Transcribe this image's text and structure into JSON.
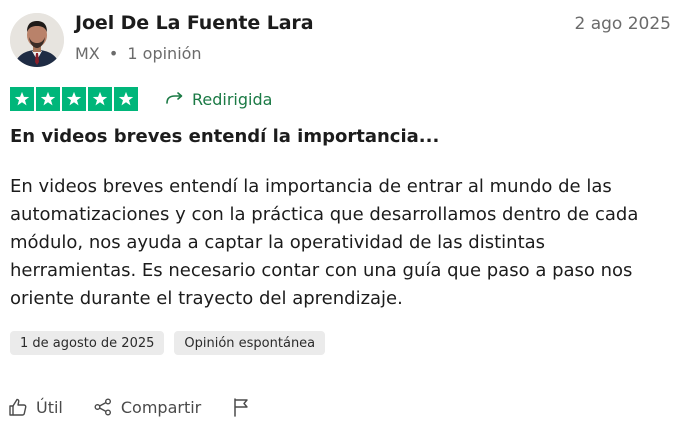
{
  "reviewer": {
    "name": "Joel De La Fuente Lara",
    "country": "MX",
    "separator": "•",
    "reviews_count": "1 opinión",
    "avatar": "profile-photo"
  },
  "review": {
    "date": "2 ago 2025",
    "rating": 5,
    "rating_max": 5,
    "star_color": "#00b67a",
    "redirect_label": "Redirigida",
    "redirect_color": "#1b7a45",
    "title": "En videos breves entendí la importancia...",
    "body": "En videos breves entendí la importancia de entrar al mundo de las automatizaciones y con la práctica que desarrollamos dentro de cada módulo, nos ayuda a captar la operatividad de las distintas herramientas. Es necesario contar con una guía que paso a paso nos oriente durante el trayecto del aprendizaje."
  },
  "tags": {
    "experience_date": "1 de agosto de 2025",
    "type": "Opinión espontánea"
  },
  "actions": {
    "useful_label": "Útil",
    "share_label": "Compartir",
    "useful_icon": "thumbs-up-icon",
    "share_icon": "share-icon",
    "report_icon": "flag-icon"
  }
}
